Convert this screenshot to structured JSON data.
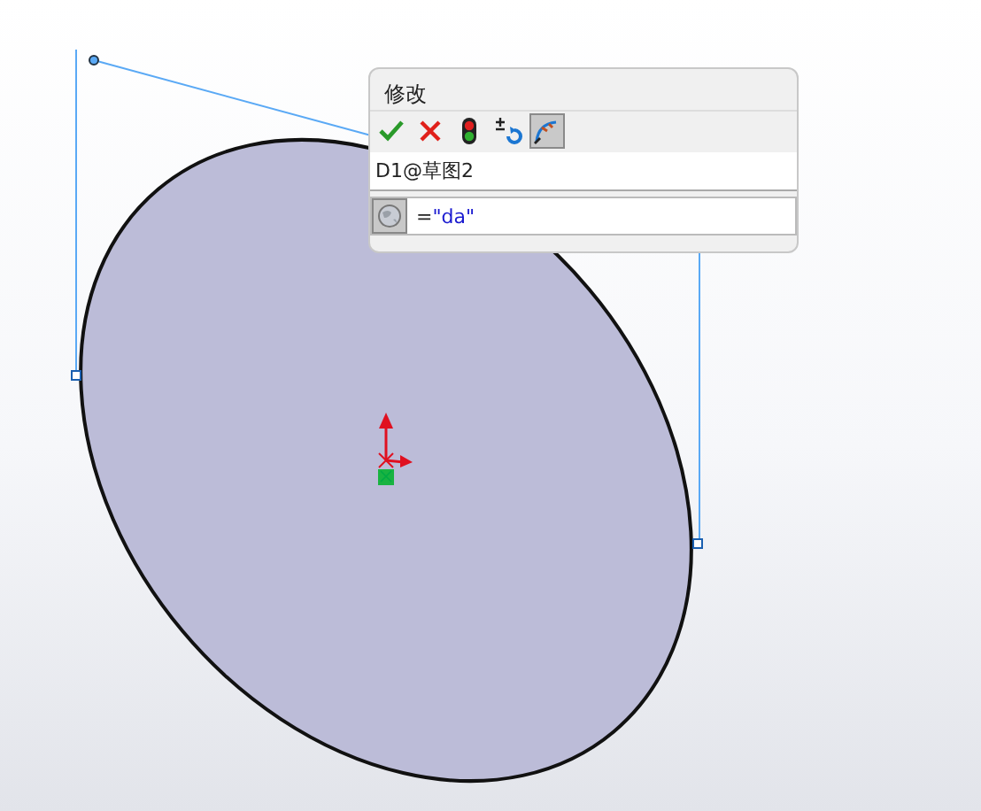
{
  "dialog": {
    "title": "修改",
    "toolbar": [
      {
        "kind": "ok",
        "selected": false
      },
      {
        "kind": "cancel",
        "selected": false
      },
      {
        "kind": "rebuild",
        "selected": false
      },
      {
        "kind": "reverse",
        "selected": false
      },
      {
        "kind": "mark",
        "selected": true
      }
    ],
    "dimension_name": "D1@草图2",
    "value_prefix": "=",
    "value": "\"da\""
  }
}
